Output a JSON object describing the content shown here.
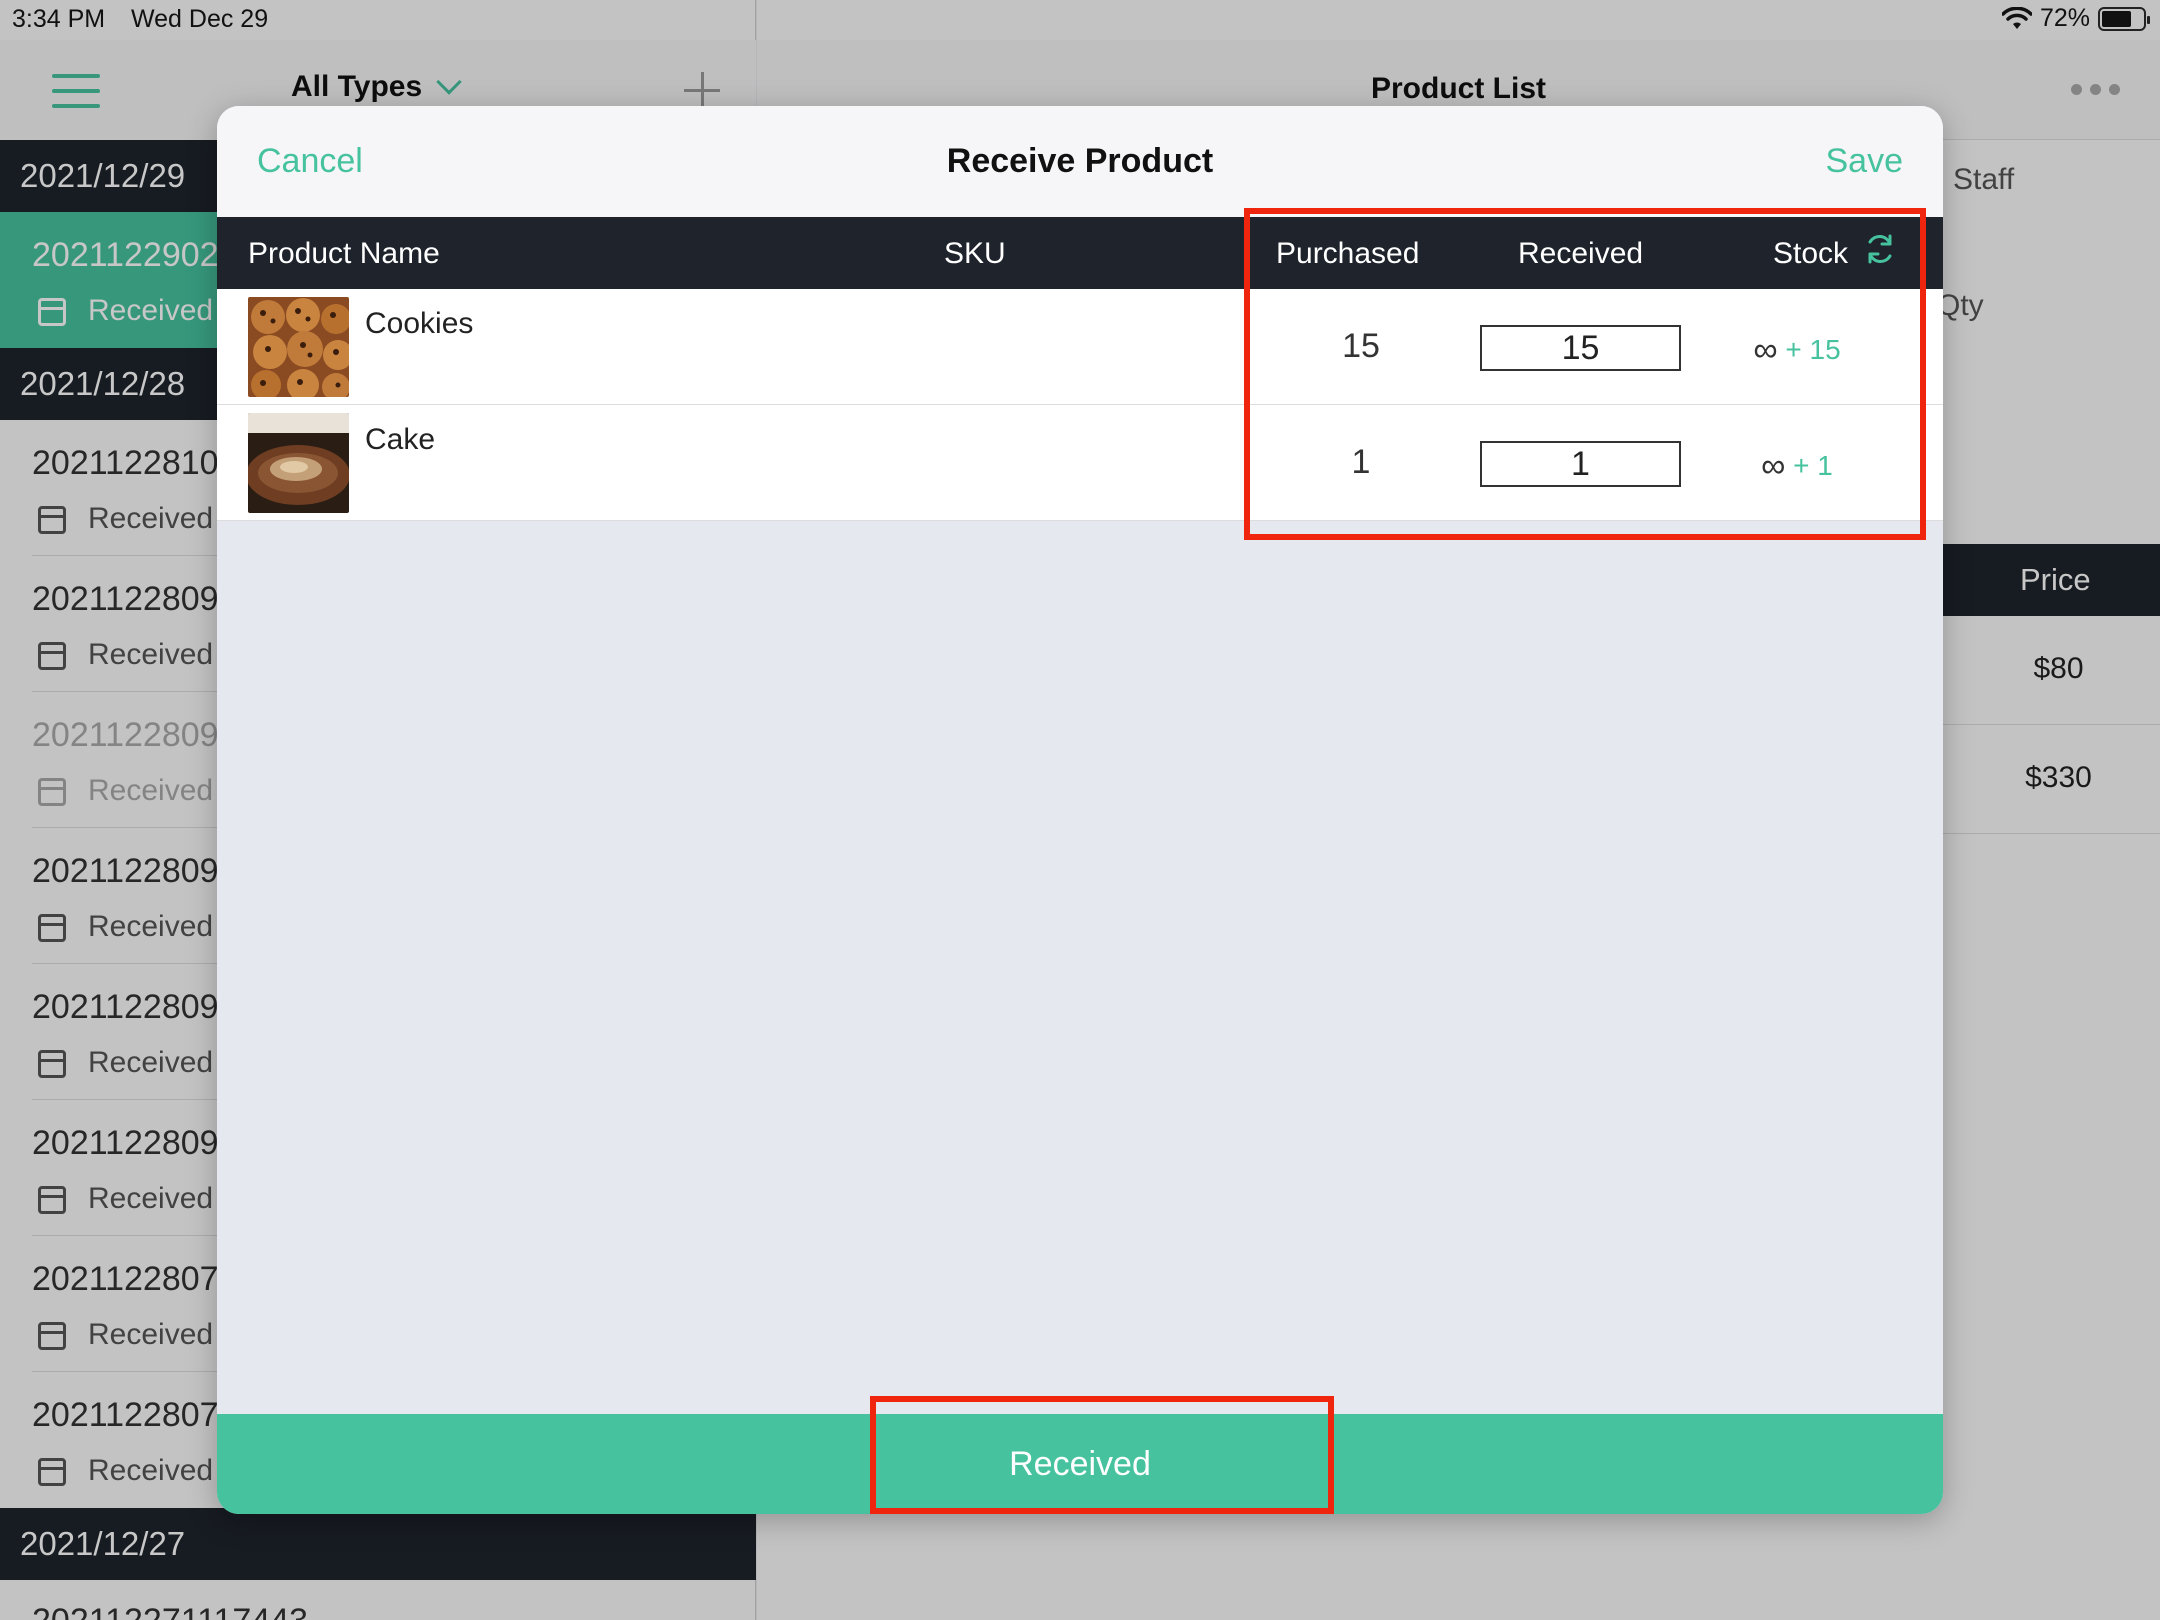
{
  "status_bar": {
    "time": "3:34 PM",
    "date": "Wed Dec 29",
    "battery": "72%"
  },
  "left": {
    "filter_label": "All Types",
    "groups": [
      {
        "date": "2021/12/29"
      },
      {
        "date": "2021/12/28"
      },
      {
        "date": "2021/12/27"
      }
    ],
    "orders": [
      {
        "number": "2021122902",
        "status": "Received"
      },
      {
        "number": "2021122810",
        "status": "Received"
      },
      {
        "number": "2021122809",
        "status": "Received"
      },
      {
        "number": "2021122809",
        "status": "Received"
      },
      {
        "number": "2021122809",
        "status": "Received"
      },
      {
        "number": "2021122809",
        "status": "Received"
      },
      {
        "number": "2021122809",
        "status": "Received"
      },
      {
        "number": "2021122807",
        "status": "Received"
      },
      {
        "number": "2021122807",
        "status": "Received"
      }
    ],
    "next_order_partial": "202112271117443"
  },
  "right": {
    "title": "Product List",
    "staff_label": "Staff",
    "qty_label": "Qty",
    "price_header": "Price",
    "prices": [
      "$80",
      "$330"
    ]
  },
  "modal": {
    "cancel_label": "Cancel",
    "title": "Receive Product",
    "save_label": "Save",
    "columns": {
      "product_name": "Product Name",
      "sku": "SKU",
      "purchased": "Purchased",
      "received": "Received",
      "stock": "Stock"
    },
    "products": [
      {
        "name": "Cookies",
        "sku": "",
        "purchased": "15",
        "received": "15",
        "stock_base": "∞",
        "stock_delta": "+ 15"
      },
      {
        "name": "Cake",
        "sku": "",
        "purchased": "1",
        "received": "1",
        "stock_base": "∞",
        "stock_delta": "+ 1"
      }
    ],
    "received_button": "Received"
  },
  "colors": {
    "accent": "#46c29e",
    "dark_header": "#1e232c",
    "highlight": "#f0250e"
  }
}
